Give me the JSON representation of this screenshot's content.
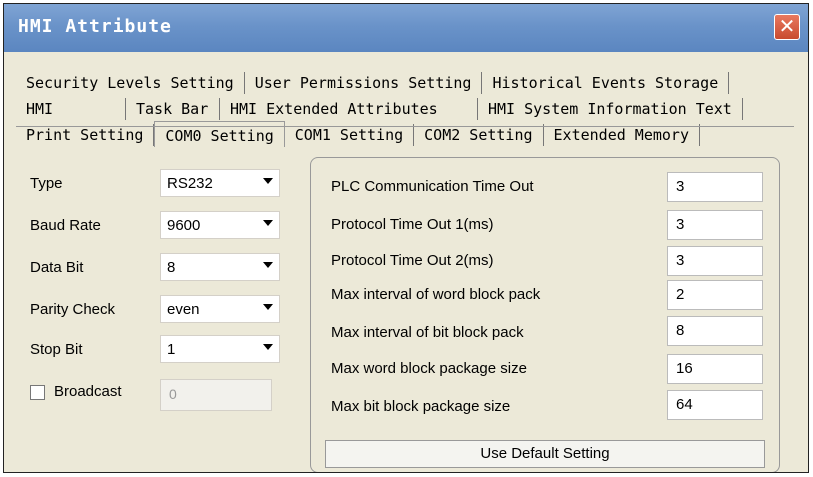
{
  "window": {
    "title": "HMI Attribute"
  },
  "tabs": {
    "row1": [
      "Security Levels Setting",
      "User Permissions Setting",
      "Historical Events Storage"
    ],
    "row2": [
      "HMI",
      "Task Bar",
      "HMI Extended Attributes",
      "HMI System Information Text"
    ],
    "row3": [
      "Print Setting",
      "COM0 Setting",
      "COM1 Setting",
      "COM2 Setting",
      "Extended Memory"
    ],
    "active": "COM0 Setting"
  },
  "left": {
    "type_label": "Type",
    "type_value": "RS232",
    "baud_label": "Baud Rate",
    "baud_value": "9600",
    "databit_label": "Data Bit",
    "databit_value": "8",
    "parity_label": "Parity Check",
    "parity_value": "even",
    "stopbit_label": "Stop Bit",
    "stopbit_value": "1",
    "broadcast_label": "Broadcast",
    "broadcast_value": "0"
  },
  "params": [
    {
      "label": "PLC Communication Time Out",
      "value": "3"
    },
    {
      "label": "Protocol Time Out 1(ms)",
      "value": "3"
    },
    {
      "label": "Protocol Time Out 2(ms)",
      "value": "3"
    },
    {
      "label": "Max interval of word block pack",
      "value": "2"
    },
    {
      "label": "Max interval of bit block pack",
      "value": "8"
    },
    {
      "label": "Max word block package size",
      "value": "16"
    },
    {
      "label": "Max bit block package size",
      "value": "64"
    }
  ],
  "buttons": {
    "use_default": "Use Default Setting"
  },
  "colors": {
    "titlebar": "#6a93c9",
    "close": "#c84a2e",
    "dialog_bg": "#ece9d8"
  },
  "icons": {
    "close": "close-icon",
    "dropdown": "chevron-down-icon"
  }
}
